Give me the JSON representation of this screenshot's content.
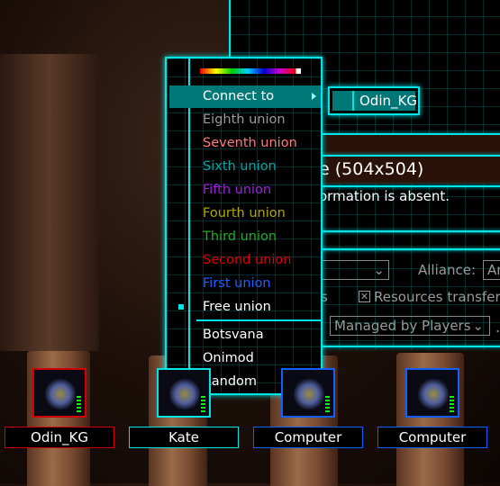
{
  "menu": {
    "items": [
      {
        "label": "Connect to",
        "color": "#ffffff",
        "highlighted": true,
        "submenu": true
      },
      {
        "label": "Eighth union",
        "color": "#9a9a9a"
      },
      {
        "label": "Seventh union",
        "color": "#ff7a7a"
      },
      {
        "label": "Sixth union",
        "color": "#00a8a8"
      },
      {
        "label": "Fifth union",
        "color": "#a020e0"
      },
      {
        "label": "Fourth union",
        "color": "#b0a800"
      },
      {
        "label": "Third union",
        "color": "#20b020"
      },
      {
        "label": "Second union",
        "color": "#e00000"
      },
      {
        "label": "First union",
        "color": "#2060ff"
      },
      {
        "label": "Free union",
        "color": "#ffffff",
        "selected": true
      },
      {
        "label": "Botsvana",
        "color": "#ffffff"
      },
      {
        "label": "Onimod",
        "color": "#ffffff"
      },
      {
        "label": "Random",
        "color": "#ffffff",
        "selected": true
      }
    ]
  },
  "tag": {
    "label": "Odin_KG"
  },
  "panel": {
    "map_title": "e (504x504)",
    "info": "ormation is absent.",
    "alliance_label": "Alliance:",
    "alliance_value": "An",
    "partial_label": "s",
    "resources_label": "Resources transfer",
    "resources_checked": true,
    "control_value": "Managed by Players",
    "trailing": "."
  },
  "players": [
    {
      "name": "Odin_KG",
      "color": "#d00000"
    },
    {
      "name": "Kate",
      "color": "#00e5e5"
    },
    {
      "name": "Computer",
      "color": "#1060ff"
    },
    {
      "name": "Computer",
      "color": "#1060ff"
    }
  ]
}
